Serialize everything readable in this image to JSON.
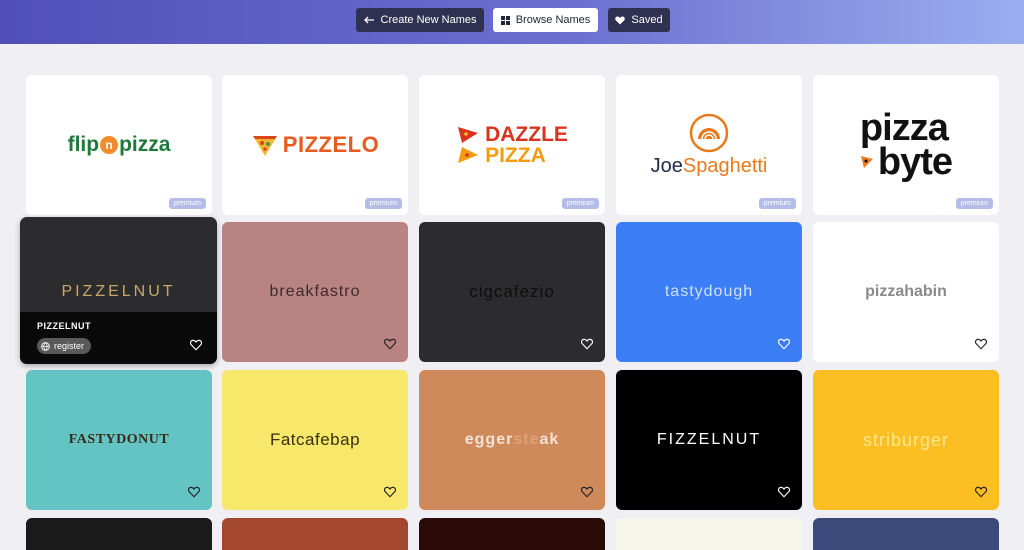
{
  "nav": {
    "create_label": "Create New Names",
    "browse_label": "Browse Names",
    "saved_label": "Saved"
  },
  "premium_label": "premium",
  "premium_logos": [
    {
      "name": "flipnpizza",
      "parts": [
        "flip",
        "n",
        "pizza"
      ]
    },
    {
      "name": "PIZZELO"
    },
    {
      "name_lines": [
        "DAZZLE",
        "PIZZA"
      ]
    },
    {
      "name_parts": [
        "Joe",
        "Spaghetti"
      ]
    },
    {
      "name_lines": [
        "pizza",
        "byte"
      ]
    }
  ],
  "hovered": {
    "wordmark": "PIZZELNUT",
    "name": "PIZZELNUT",
    "register_label": "register"
  },
  "names_row2": [
    "breakfastro",
    "cigcafezio",
    "tastydough",
    "pizzahabin"
  ],
  "names_row3": [
    "FASTYDONUT",
    "Fatcafebap",
    "eggersteak",
    "FIZZELNUT",
    "striburger"
  ],
  "eggersteak_parts": [
    "egger",
    "ste",
    "ak"
  ],
  "colors": {
    "accent": "#5050b8",
    "card_breakfastro": "#b98381",
    "card_cigcafezio": "#2c2c2e",
    "card_tastydough": "#3c7ef5",
    "card_fastydonut": "#64c3c3",
    "card_fatcafebap": "#f7e76a",
    "card_eggersteak": "#cf8a5c",
    "card_fizzelnut": "#000000",
    "card_striburger": "#fbbf24"
  }
}
